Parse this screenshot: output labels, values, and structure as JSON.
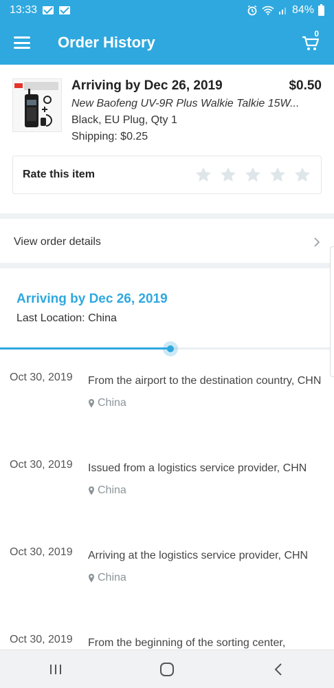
{
  "status_bar": {
    "time": "13:33",
    "battery": "84%",
    "icons": [
      "mail-icon",
      "mail-icon",
      "alarm-icon",
      "wifi-icon",
      "signal-icon",
      "battery-icon"
    ]
  },
  "app_bar": {
    "title": "Order History",
    "cart_count": "0",
    "icons": [
      "menu-icon",
      "cart-icon"
    ]
  },
  "order": {
    "arriving": "Arriving by Dec 26, 2019",
    "price": "$0.50",
    "name": "New Baofeng UV-9R Plus Walkie Talkie 15W...",
    "variant": "Black, EU Plug, Qty 1",
    "shipping": "Shipping: $0.25",
    "rate_label": "Rate this item",
    "rating": 0,
    "rating_max": 5
  },
  "view_details": {
    "label": "View order details"
  },
  "tracking": {
    "title": "Arriving by Dec 26, 2019",
    "last_location": "Last Location: China",
    "progress": 0.51,
    "events": [
      {
        "date": "Oct 30, 2019",
        "desc": "From the airport to the destination country, CHN",
        "loc": "China"
      },
      {
        "date": "Oct 30, 2019",
        "desc": "Issued from a logistics service provider, CHN",
        "loc": "China"
      },
      {
        "date": "Oct 30, 2019",
        "desc": "Arriving at the logistics service provider, CHN",
        "loc": "China"
      },
      {
        "date": "Oct 30, 2019",
        "desc": "From the beginning of the sorting center,",
        "loc": ""
      }
    ]
  },
  "nav_bar": {
    "icons": [
      "recent-apps-icon",
      "home-icon",
      "back-icon"
    ]
  },
  "colors": {
    "accent": "#2fa8df",
    "star_empty": "#dfe6ea",
    "divider": "#eef2f5"
  }
}
